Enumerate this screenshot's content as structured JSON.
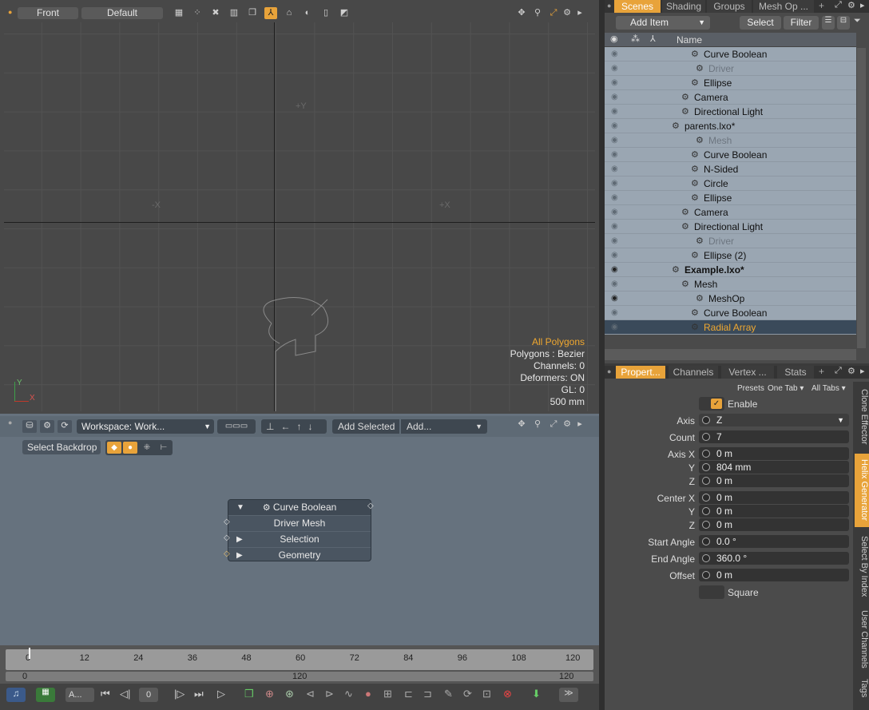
{
  "viewport": {
    "view": "Front",
    "style": "Default",
    "axis_y": "+Y",
    "axis_nx": "-X",
    "axis_px": "+X",
    "info": {
      "line1": "All Polygons",
      "line2": "Polygons : Bezier",
      "line3": "Channels: 0",
      "line4": "Deformers: ON",
      "line5": "GL: 0",
      "line6": "500 mm"
    }
  },
  "schematic": {
    "workspace": "Workspace: Work...",
    "add_selected": "Add Selected",
    "add": "Add...",
    "select_backdrop": "Select Backdrop",
    "node": {
      "title": "Curve Boolean",
      "rows": [
        "Driver Mesh",
        "Selection",
        "Geometry"
      ]
    }
  },
  "timeline": {
    "ticks": [
      "0",
      "12",
      "24",
      "36",
      "48",
      "60",
      "72",
      "84",
      "96",
      "108",
      "120"
    ],
    "start": "0",
    "mid": "120",
    "end": "120",
    "frame": "0",
    "clip": "A..."
  },
  "scenes": {
    "tabs": [
      "Scenes",
      "Shading",
      "Groups",
      "Mesh Op ..."
    ],
    "add_item": "Add Item",
    "select": "Select",
    "filter": "Filter",
    "col_name": "Name",
    "rows": [
      {
        "label": "Curve Boolean",
        "indent": 124,
        "dim": false,
        "bold": false
      },
      {
        "label": "Driver",
        "indent": 130,
        "dim": true,
        "bold": false
      },
      {
        "label": "Ellipse",
        "indent": 124,
        "dim": false,
        "bold": false
      },
      {
        "label": "Camera",
        "indent": 112,
        "dim": false,
        "bold": false
      },
      {
        "label": "Directional Light",
        "indent": 112,
        "dim": false,
        "bold": false
      },
      {
        "label": "parents.lxo*",
        "indent": 100,
        "dim": false,
        "bold": false
      },
      {
        "label": "Mesh",
        "indent": 130,
        "dim": true,
        "bold": false
      },
      {
        "label": "Curve Boolean",
        "indent": 124,
        "dim": false,
        "bold": false
      },
      {
        "label": "N-Sided",
        "indent": 124,
        "dim": false,
        "bold": false
      },
      {
        "label": "Circle",
        "indent": 124,
        "dim": false,
        "bold": false
      },
      {
        "label": "Ellipse",
        "indent": 124,
        "dim": false,
        "bold": false
      },
      {
        "label": "Camera",
        "indent": 112,
        "dim": false,
        "bold": false
      },
      {
        "label": "Directional Light",
        "indent": 112,
        "dim": false,
        "bold": false
      },
      {
        "label": "Driver",
        "indent": 130,
        "dim": true,
        "bold": false
      },
      {
        "label": "Ellipse (2)",
        "indent": 124,
        "dim": false,
        "bold": false
      },
      {
        "label": "Example.lxo*",
        "indent": 100,
        "dim": false,
        "bold": true
      },
      {
        "label": "Mesh",
        "indent": 112,
        "dim": false,
        "bold": false
      },
      {
        "label": "MeshOp",
        "indent": 130,
        "dim": false,
        "bold": false
      },
      {
        "label": "Curve Boolean",
        "indent": 124,
        "dim": false,
        "bold": false
      },
      {
        "label": "Radial Array",
        "indent": 124,
        "dim": false,
        "bold": false,
        "selected": true
      }
    ]
  },
  "properties": {
    "tabs": [
      "Propert...",
      "Channels",
      "Vertex ...",
      "Stats"
    ],
    "presets": "Presets",
    "one_tab": "One Tab",
    "all_tabs": "All Tabs",
    "enable": "Enable",
    "axis_label": "Axis",
    "axis": "Z",
    "count_label": "Count",
    "count": "7",
    "axis_x_label": "Axis X",
    "y_label": "Y",
    "z_label": "Z",
    "axis_x": "0 m",
    "axis_y": "804 mm",
    "axis_z": "0 m",
    "center_x_label": "Center X",
    "center_x": "0 m",
    "center_y": "0 m",
    "center_z": "0 m",
    "start_angle_label": "Start Angle",
    "start_angle": "0.0 °",
    "end_angle_label": "End Angle",
    "end_angle": "360.0 °",
    "offset_label": "Offset",
    "offset": "0 m",
    "square": "Square",
    "side_tabs": [
      "Clone Effector",
      "Helix Generator",
      "Select By Index",
      "User Channels",
      "Tags"
    ]
  },
  "colors": {
    "accent": "#e8a33a",
    "selected_text": "#f0a830"
  }
}
